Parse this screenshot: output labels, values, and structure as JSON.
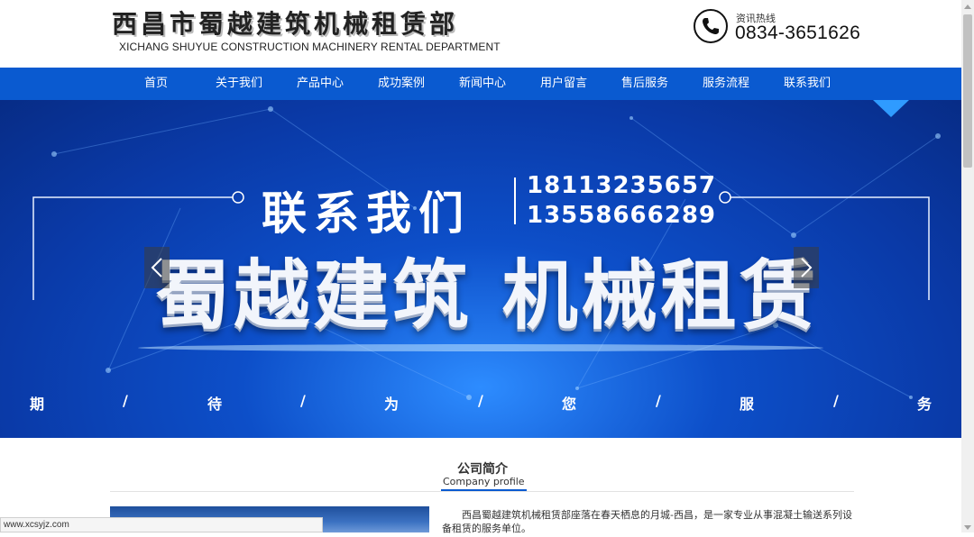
{
  "header": {
    "logo_cn": "西昌市蜀越建筑机械租赁部",
    "logo_en": "XICHANG SHUYUE CONSTRUCTION MACHINERY RENTAL DEPARTMENT",
    "hotline_label": "资讯热线",
    "hotline_number": "0834-3651626",
    "phone_icon": "phone-icon"
  },
  "nav": {
    "items": [
      "首页",
      "关于我们",
      "产品中心",
      "成功案例",
      "新闻中心",
      "用户留言",
      "售后服务",
      "服务流程",
      "联系我们"
    ],
    "bg_color": "#0a5ad0"
  },
  "banner": {
    "contact_title": "联系我们",
    "phone1": "18113235657",
    "phone2": "13558666289",
    "slogan": "蜀越建筑 机械租赁",
    "tagline": [
      "期",
      "/",
      "待",
      "/",
      "为",
      "/",
      "您",
      "/",
      "服",
      "/",
      "务"
    ],
    "prev_icon": "chevron-left-icon",
    "next_icon": "chevron-right-icon"
  },
  "intro": {
    "title": "公司简介",
    "subtitle": "Company profile",
    "text": "西昌蜀越建筑机械租赁部座落在春天栖息的月城-西昌，是一家专业从事混凝土输送系列设备租赁的服务单位。"
  },
  "status_bar": {
    "url": "www.xcsyjz.com"
  }
}
